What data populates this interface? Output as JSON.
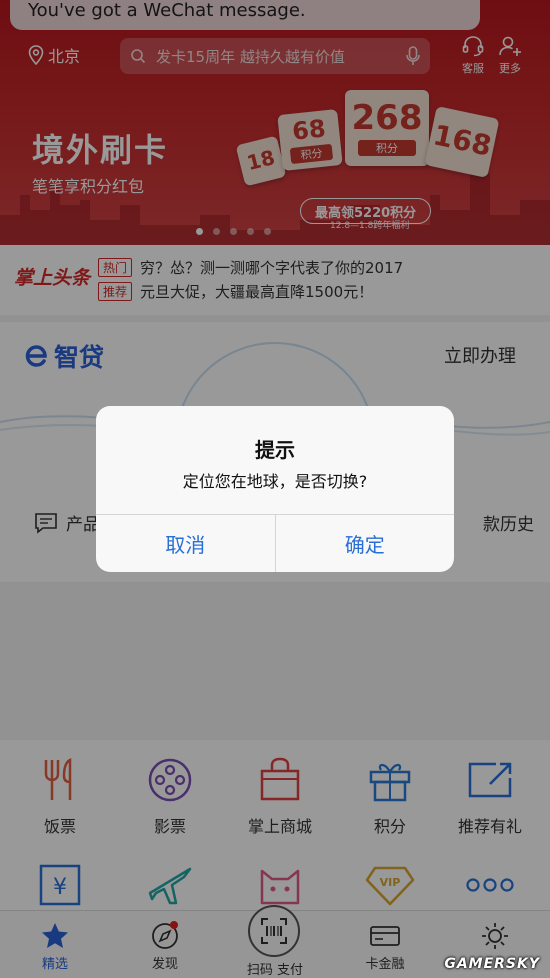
{
  "notification": {
    "text": "You've got a WeChat message."
  },
  "header": {
    "location": "北京",
    "search_placeholder": "发卡15周年 越持久越有价值",
    "service_label": "客服",
    "more_label": "更多"
  },
  "banner": {
    "title": "境外刷卡",
    "subtitle": "笔笔享积分红包",
    "tickets": [
      {
        "value": "18",
        "unit": ""
      },
      {
        "value": "68",
        "unit": "积分"
      },
      {
        "value": "268",
        "unit": "积分"
      },
      {
        "value": "168",
        "unit": ""
      }
    ],
    "promo": "最高领5220积分",
    "promo_date": "12.8—1.8跨年福利",
    "active_slide": 1,
    "slide_count": 5
  },
  "headlines": {
    "logo": "掌上头条",
    "items": [
      {
        "tag": "热门",
        "text": "穷？怂？测一测哪个字代表了你的2017"
      },
      {
        "tag": "推荐",
        "text": "元旦大促，大疆最高直降1500元！"
      }
    ]
  },
  "loan": {
    "logo_text": "智贷",
    "apply_label": "立即办理",
    "left_text": "产品",
    "right_text": "款历史"
  },
  "alert": {
    "title": "提示",
    "message": "定位您在地球，是否切换?",
    "cancel": "取消",
    "confirm": "确定"
  },
  "grid": {
    "items": [
      {
        "label": "饭票",
        "icon": "fork-knife-icon"
      },
      {
        "label": "影票",
        "icon": "film-reel-icon"
      },
      {
        "label": "掌上商城",
        "icon": "shopping-bag-icon"
      },
      {
        "label": "积分",
        "icon": "gift-box-icon"
      },
      {
        "label": "推荐有礼",
        "icon": "share-box-icon"
      },
      {
        "label": "",
        "icon": "yen-icon"
      },
      {
        "label": "",
        "icon": "airplane-icon"
      },
      {
        "label": "",
        "icon": "cat-icon"
      },
      {
        "label": "",
        "icon": "vip-diamond-icon"
      },
      {
        "label": "",
        "icon": "more-dots-icon"
      }
    ]
  },
  "tabbar": {
    "tabs": [
      {
        "label": "精选",
        "icon": "star-icon",
        "active": true
      },
      {
        "label": "发现",
        "icon": "compass-icon"
      },
      {
        "label": "扫码 支付",
        "icon": "scan-icon"
      },
      {
        "label": "卡金融",
        "icon": "card-icon"
      },
      {
        "label": "",
        "icon": "settings-icon"
      }
    ]
  },
  "watermark": "GAMERSKY",
  "colors": {
    "brand_red": "#c62a2c",
    "ios_blue": "#2a6fd6",
    "loan_blue": "#2a62d6"
  }
}
